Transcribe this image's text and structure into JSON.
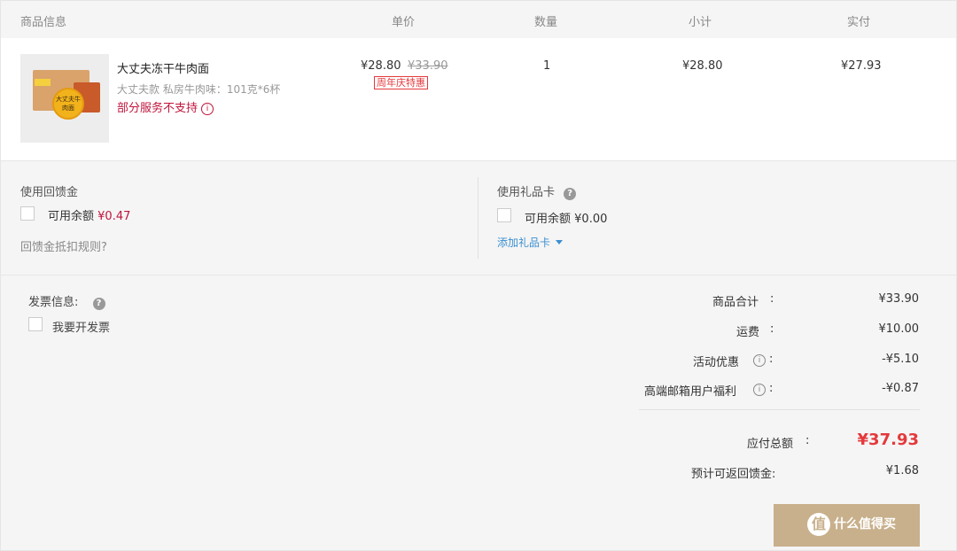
{
  "header": {
    "col_product": "商品信息",
    "col_unit_price": "单价",
    "col_quantity": "数量",
    "col_subtotal": "小计",
    "col_actual": "实付"
  },
  "product": {
    "title": "大丈夫冻干牛肉面",
    "spec": "大丈夫款 私房牛肉味：101克*6杯",
    "warning": "部分服务不支持",
    "image_text": "大丈夫牛肉面",
    "price": "¥28.80",
    "original_price": "¥33.90",
    "promo_tag": "周年庆特惠",
    "quantity": "1",
    "subtotal": "¥28.80",
    "actual_paid": "¥27.93"
  },
  "cashback": {
    "title": "使用回馈金",
    "balance_label": "可用余额",
    "balance_value": "¥0.47",
    "rules_link": "回馈金抵扣规则?"
  },
  "giftcard": {
    "title": "使用礼品卡",
    "balance_label": "可用余额",
    "balance_value": "¥0.00",
    "add_link": "添加礼品卡"
  },
  "invoice": {
    "title": "发票信息:",
    "checkbox_label": "我要开发票"
  },
  "summary": {
    "goods_total_label": "商品合计",
    "goods_total_value": "¥33.90",
    "shipping_label": "运费",
    "shipping_value": "¥10.00",
    "promo_label": "活动优惠",
    "promo_value": "-¥5.10",
    "member_label": "高端邮箱用户福利",
    "member_value": "-¥0.87",
    "colon": ":",
    "total_label": "应付总额",
    "total_value": "¥37.93",
    "cashback_label": "预计可返回馈金:",
    "cashback_value": "¥1.68"
  },
  "watermark": {
    "logo": "值",
    "text": "什么值得买"
  },
  "colors": {
    "accent_red": "#e4393c",
    "warning_red": "#c0143c",
    "link_blue": "#3b8fd1",
    "button_tan": "#c8b08c"
  }
}
